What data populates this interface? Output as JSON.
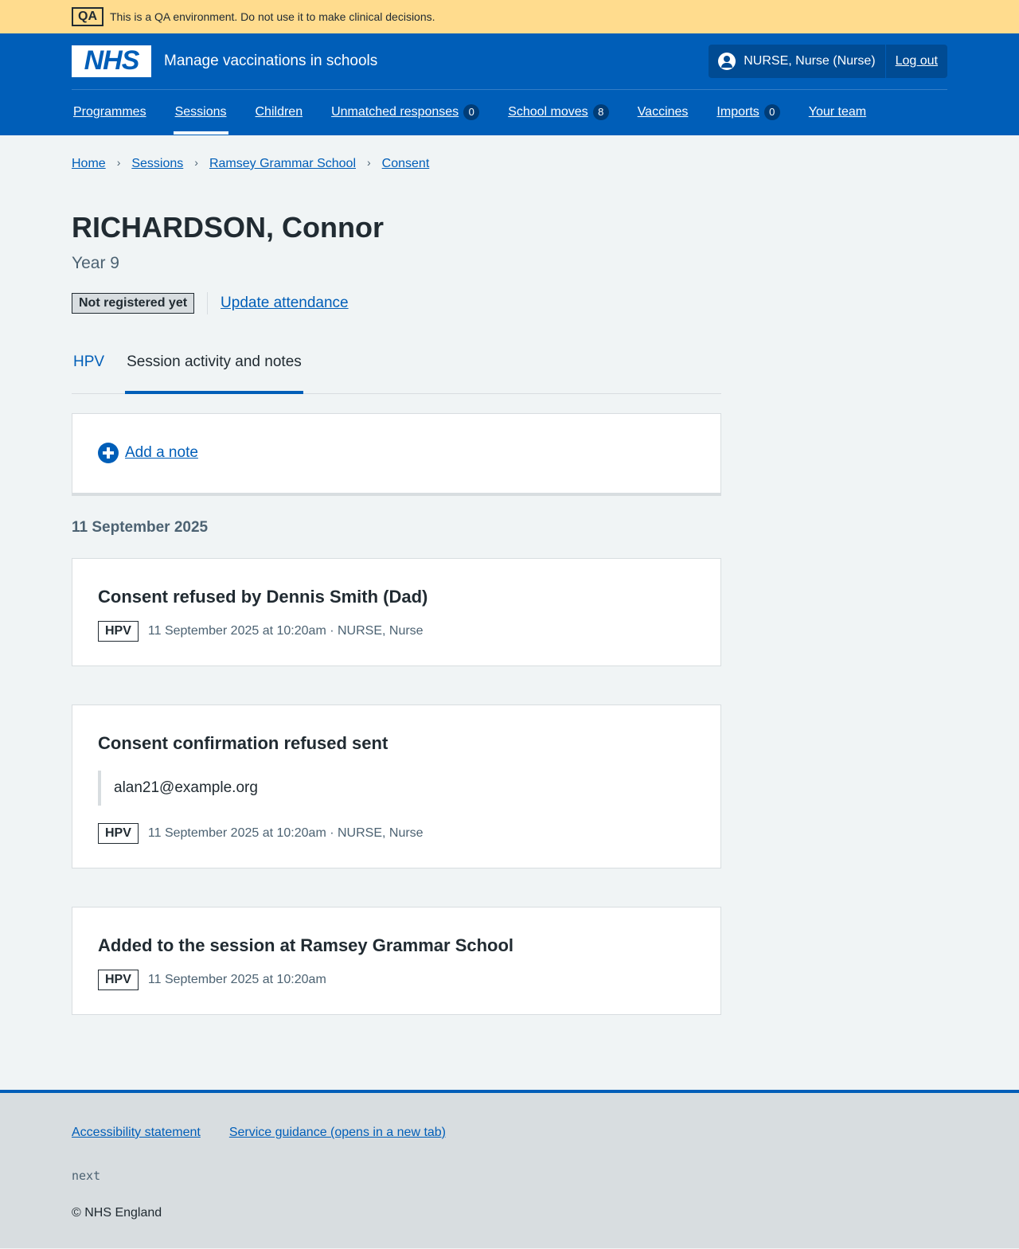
{
  "qa_banner": {
    "tag": "QA",
    "text": "This is a QA environment. Do not use it to make clinical decisions."
  },
  "header": {
    "logo_text": "NHS",
    "service_name": "Manage vaccinations in schools",
    "user": "NURSE, Nurse (Nurse)",
    "logout": "Log out",
    "nav": [
      {
        "label": "Programmes",
        "count": null
      },
      {
        "label": "Sessions",
        "count": null,
        "active": true
      },
      {
        "label": "Children",
        "count": null
      },
      {
        "label": "Unmatched responses",
        "count": "0"
      },
      {
        "label": "School moves",
        "count": "8"
      },
      {
        "label": "Vaccines",
        "count": null
      },
      {
        "label": "Imports",
        "count": "0"
      },
      {
        "label": "Your team",
        "count": null
      }
    ]
  },
  "breadcrumbs": [
    "Home",
    "Sessions",
    "Ramsey Grammar School",
    "Consent"
  ],
  "page": {
    "title": "RICHARDSON, Connor",
    "caption": "Year 9",
    "status_tag": "Not registered yet",
    "status_link": "Update attendance"
  },
  "tabs": [
    {
      "label": "HPV",
      "selected": false
    },
    {
      "label": "Session activity and notes",
      "selected": true
    }
  ],
  "add_note": "Add a note",
  "date_heading": "11 September 2025",
  "events": [
    {
      "title": "Consent refused by Dennis Smith (Dad)",
      "tag": "HPV",
      "meta": "11 September 2025 at 10:20am · NURSE, Nurse",
      "inset": null
    },
    {
      "title": "Consent confirmation refused sent",
      "tag": "HPV",
      "meta": "11 September 2025 at 10:20am · NURSE, Nurse",
      "inset": "alan21@example.org"
    },
    {
      "title": "Added to the session at Ramsey Grammar School",
      "tag": "HPV",
      "meta": "11 September 2025 at 10:20am",
      "inset": null
    }
  ],
  "footer": {
    "links": [
      "Accessibility statement",
      "Service guidance (opens in a new tab)"
    ],
    "version": "next",
    "copyright": "© NHS England"
  },
  "colors": {
    "brand": "#005eb8",
    "qa_banner": "#ffdc8e",
    "page_bg": "#f0f4f5"
  }
}
